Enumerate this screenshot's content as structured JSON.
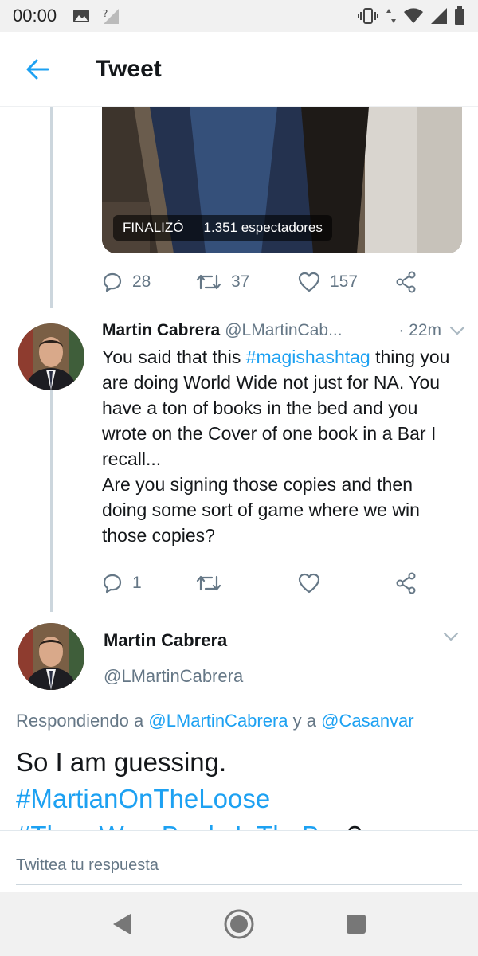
{
  "status_bar": {
    "time": "00:00",
    "icons": [
      "image-icon",
      "no-signal-icon",
      "vibrate-icon",
      "data-arrows-icon",
      "wifi-icon",
      "signal-icon",
      "battery-icon"
    ]
  },
  "header": {
    "title": "Tweet",
    "back_icon": "arrow-left-icon"
  },
  "previous_tweet": {
    "video_status": "FINALIZÓ",
    "viewers": "1.351 espectadores",
    "replies": "28",
    "retweets": "37",
    "likes": "157"
  },
  "reply_tweet": {
    "name": "Martin Cabrera",
    "handle": "@LMartinCab...",
    "time": "· 22m",
    "text_1": "You said that this ",
    "hashtag": "#magishashtag",
    "text_2": " thing you are doing World Wide not just for NA. You have a ton of books in the bed and you wrote on the Cover of one book in a Bar I recall...",
    "text_3": "Are you signing those copies and then doing some sort of game where we win those copies?",
    "replies": "1"
  },
  "main_tweet": {
    "name": "Martin Cabrera",
    "handle": "@LMartinCabrera",
    "replying_prefix": "Respondiendo a ",
    "replying_user_1": "@LMartinCabrera",
    "replying_join": " y a ",
    "replying_user_2": "@Casanvar",
    "text": "So I am guessing.",
    "hashtag_1": "#MartianOnTheLoose",
    "hashtag_2": "#ThereWereBooksInTheBox",
    "text_end": "?"
  },
  "composer": {
    "placeholder": "Twittea tu respuesta"
  },
  "colors": {
    "accent": "#1da1f2",
    "secondary_text": "#657786",
    "primary_text": "#14171a"
  }
}
